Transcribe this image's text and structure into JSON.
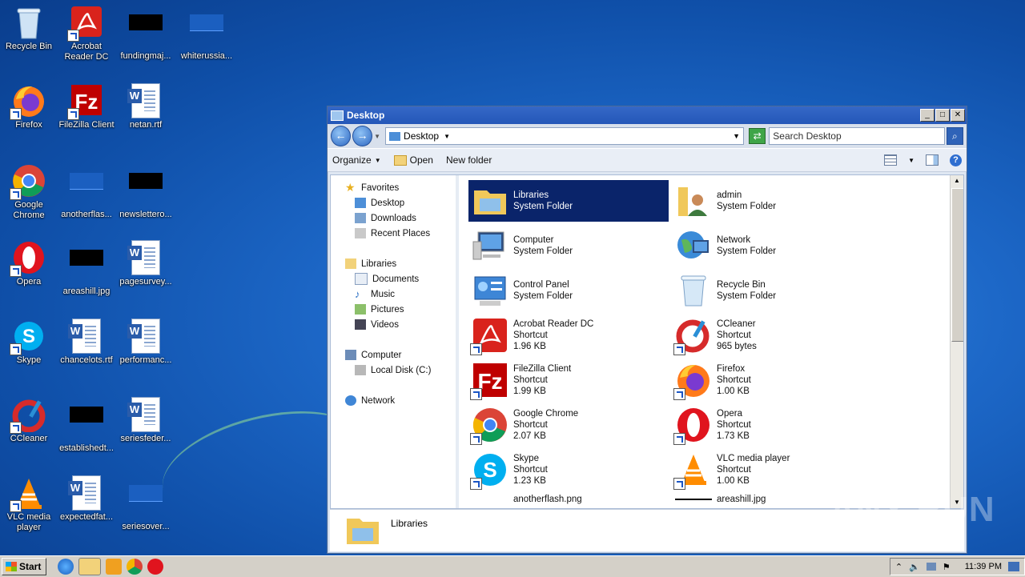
{
  "desktop": {
    "icons": [
      {
        "label": "Recycle Bin"
      },
      {
        "label": "Acrobat Reader DC"
      },
      {
        "label": "fundingmaj..."
      },
      {
        "label": "whiterussia..."
      },
      {
        "label": "Firefox"
      },
      {
        "label": "FileZilla Client"
      },
      {
        "label": "netan.rtf"
      },
      {
        "label": "Google Chrome"
      },
      {
        "label": "anotherflas..."
      },
      {
        "label": "newslettero..."
      },
      {
        "label": "Opera"
      },
      {
        "label": "areashill.jpg"
      },
      {
        "label": "pagesurvey..."
      },
      {
        "label": "Skype"
      },
      {
        "label": "chancelots.rtf"
      },
      {
        "label": "performanc..."
      },
      {
        "label": "CCleaner"
      },
      {
        "label": "establishedt..."
      },
      {
        "label": "seriesfeder..."
      },
      {
        "label": "VLC media player"
      },
      {
        "label": "expectedfat..."
      },
      {
        "label": "seriesover..."
      }
    ]
  },
  "window": {
    "title": "Desktop",
    "address": "Desktop",
    "search_placeholder": "Search Desktop",
    "toolbar": {
      "organize": "Organize",
      "open": "Open",
      "new_folder": "New folder"
    },
    "nav": {
      "favorites": "Favorites",
      "desktop": "Desktop",
      "downloads": "Downloads",
      "recent": "Recent Places",
      "libraries": "Libraries",
      "documents": "Documents",
      "music": "Music",
      "pictures": "Pictures",
      "videos": "Videos",
      "computer": "Computer",
      "local_disk": "Local Disk (C:)",
      "network": "Network"
    },
    "files": [
      {
        "name": "Libraries",
        "type": "System Folder",
        "size": ""
      },
      {
        "name": "admin",
        "type": "System Folder",
        "size": ""
      },
      {
        "name": "Computer",
        "type": "System Folder",
        "size": ""
      },
      {
        "name": "Network",
        "type": "System Folder",
        "size": ""
      },
      {
        "name": "Control Panel",
        "type": "System Folder",
        "size": ""
      },
      {
        "name": "Recycle Bin",
        "type": "System Folder",
        "size": ""
      },
      {
        "name": "Acrobat Reader DC",
        "type": "Shortcut",
        "size": "1.96 KB"
      },
      {
        "name": "CCleaner",
        "type": "Shortcut",
        "size": "965 bytes"
      },
      {
        "name": "FileZilla Client",
        "type": "Shortcut",
        "size": "1.99 KB"
      },
      {
        "name": "Firefox",
        "type": "Shortcut",
        "size": "1.00 KB"
      },
      {
        "name": "Google Chrome",
        "type": "Shortcut",
        "size": "2.07 KB"
      },
      {
        "name": "Opera",
        "type": "Shortcut",
        "size": "1.73 KB"
      },
      {
        "name": "Skype",
        "type": "Shortcut",
        "size": "1.23 KB"
      },
      {
        "name": "VLC media player",
        "type": "Shortcut",
        "size": "1.00 KB"
      },
      {
        "name": "anotherflash.png",
        "type": "",
        "size": ""
      },
      {
        "name": "areashill.jpg",
        "type": "",
        "size": ""
      }
    ],
    "details_name": "Libraries"
  },
  "taskbar": {
    "start": "Start",
    "clock": "11:39 PM"
  },
  "watermark": "ANY RUN"
}
